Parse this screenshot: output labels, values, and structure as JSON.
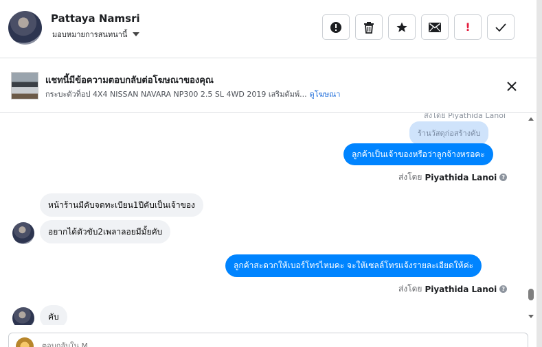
{
  "header": {
    "contact_name": "Pattaya Namsri",
    "assign_label": "มอบหมายการสนทนานี้",
    "toolbar": [
      {
        "name": "report-button",
        "icon": "alert-circle-icon"
      },
      {
        "name": "delete-button",
        "icon": "trash-icon"
      },
      {
        "name": "star-button",
        "icon": "star-icon"
      },
      {
        "name": "mark-unread-button",
        "icon": "envelope-icon"
      },
      {
        "name": "follow-up-button",
        "icon": "exclamation-icon",
        "text": "!"
      },
      {
        "name": "mark-done-button",
        "icon": "check-icon"
      }
    ]
  },
  "ad_banner": {
    "title": "แชทนี้มีข้อความตอบกลับต่อโฆษณาของคุณ",
    "description": "กระบะตัวท็อป 4X4 NISSAN NAVARA NP300 2.5 SL 4WD 2019 เสริมดัมพ์...",
    "link": "ดูโฆษณา"
  },
  "messages": {
    "cut_sender": "ส่งโดย Piyathida Lanoi",
    "items": [
      {
        "direction": "out",
        "text": "ร้านวัสดุก่อสร้างคับ",
        "style": "light"
      },
      {
        "direction": "out",
        "text": "ลูกค้าเป็นเจ้าของหรือว่าลูกจ้างหรอคะ"
      },
      {
        "direction": "in",
        "text": "หน้าร้านมีคับจดทะเบียน1ปีคับเป็นเจ้าของ"
      },
      {
        "direction": "in",
        "text": "อยากได้ตัวขับ2เพลาลอยมีมั้ยคับ"
      },
      {
        "direction": "out",
        "text": "ลูกค้าสะดวกให้เบอร์โทรไหมคะ จะให้เซลล์โทรแจ้งรายละเอียดให้ค่ะ"
      },
      {
        "direction": "in",
        "text": "คับ"
      }
    ],
    "sender_prefix": "ส่งโดย",
    "sender_name": "Piyathida Lanoi",
    "info_glyph": "?"
  },
  "composer": {
    "placeholder": "ตอบกลับใน M..."
  },
  "colors": {
    "outgoing_bubble": "#0084ff",
    "incoming_bubble": "#f0f2f5",
    "link": "#216fdb"
  }
}
